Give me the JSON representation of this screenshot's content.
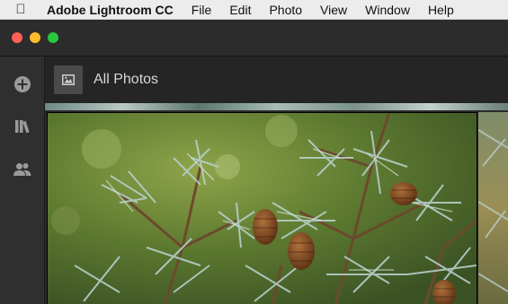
{
  "menubar": {
    "apple_icon": "apple-icon",
    "items": [
      "Adobe Lightroom CC",
      "File",
      "Edit",
      "Photo",
      "View",
      "Window",
      "Help"
    ]
  },
  "window": {
    "traffic_lights": [
      "close",
      "minimize",
      "zoom"
    ]
  },
  "rail": {
    "icons": [
      "add-photo-icon",
      "library-icon",
      "people-icon"
    ]
  },
  "header": {
    "title": "All Photos",
    "view_icon": "photo-view-icon"
  },
  "colors": {
    "menubar_bg": "#ececec",
    "window_bg": "#2c2c2c",
    "rail_bg": "#2f2f2f",
    "header_bg": "#252525",
    "text": "#d8d8d8"
  },
  "grid": {
    "photos": [
      "spruce-branch-with-pinecones",
      "spruce-branch-partial"
    ]
  }
}
